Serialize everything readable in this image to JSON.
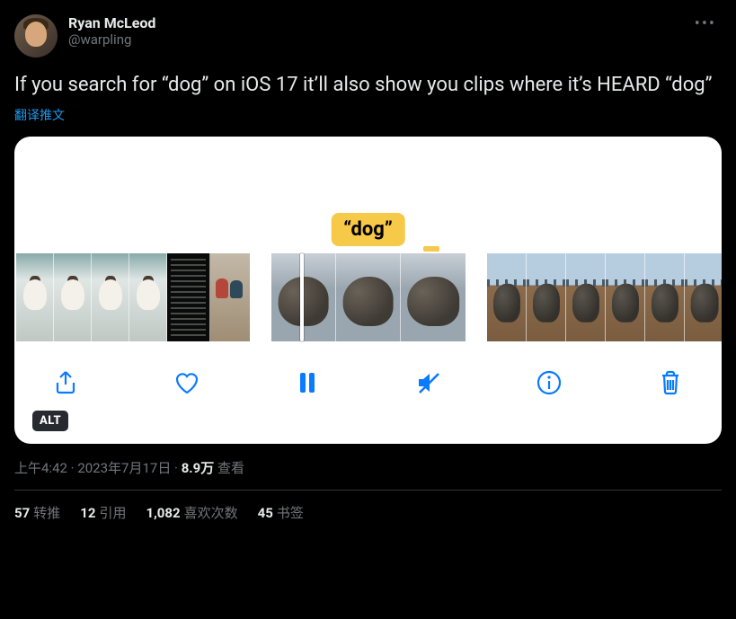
{
  "author": {
    "display_name": "Ryan McLeod",
    "handle": "@warpling"
  },
  "content": "If you search for “dog” on iOS 17 it’ll also show you clips where it’s HEARD “dog”",
  "translate_label": "翻译推文",
  "media": {
    "caption": "“dog”",
    "alt_badge": "ALT",
    "tools": {
      "share": "share",
      "heart": "heart",
      "pause": "pause",
      "mute": "mute",
      "info": "info",
      "trash": "trash"
    }
  },
  "meta": {
    "time": "上午4:42",
    "sep1": " · ",
    "date": "2023年7月17日",
    "sep2": " · ",
    "views_num": "8.9万",
    "views_label": " 查看"
  },
  "stats": {
    "retweets": {
      "num": "57",
      "label": "转推"
    },
    "quotes": {
      "num": "12",
      "label": "引用"
    },
    "likes": {
      "num": "1,082",
      "label": "喜欢次数"
    },
    "bookmarks": {
      "num": "45",
      "label": "书签"
    }
  }
}
